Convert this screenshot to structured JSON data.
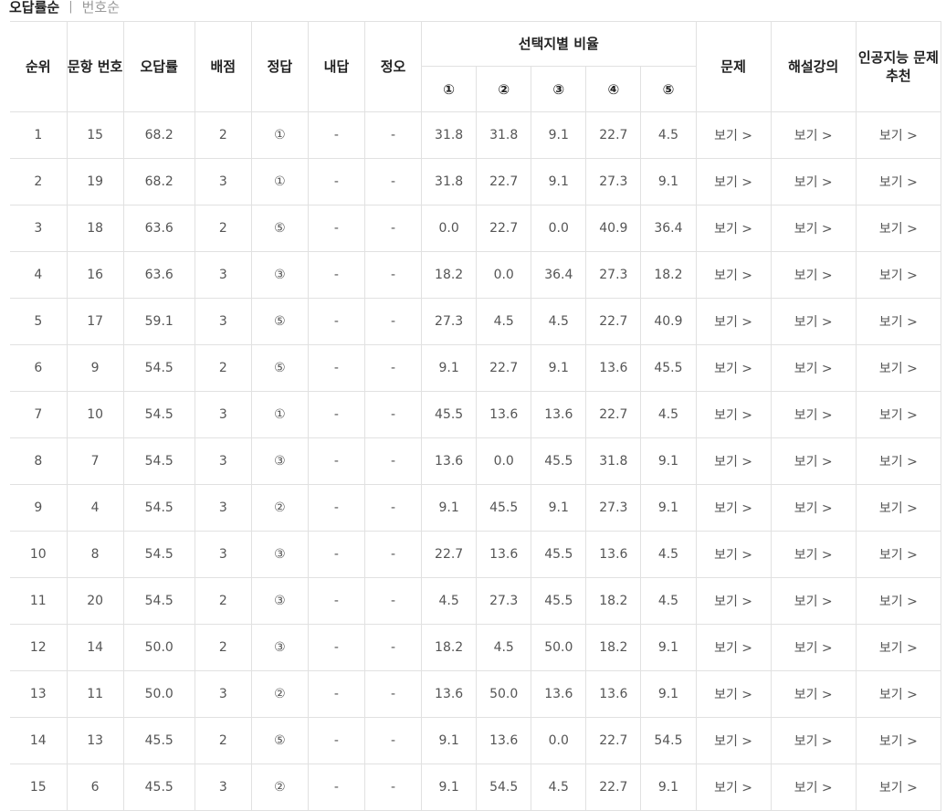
{
  "sort": {
    "active_label": "오답률순",
    "separator": "|",
    "inactive_label": "번호순"
  },
  "table": {
    "headers": {
      "rank": "순위",
      "question_no": "문항 번호",
      "wrong_rate": "오답률",
      "points": "배점",
      "answer": "정답",
      "my_answer": "내답",
      "correctness": "정오",
      "choice_ratio": "선택지별 비율",
      "choices": [
        "①",
        "②",
        "③",
        "④",
        "⑤"
      ],
      "problem": "문제",
      "lecture": "해설강의",
      "ai": "인공지능 문제추천"
    },
    "link_label": "보기 >",
    "rows": [
      {
        "rank": "1",
        "q": "15",
        "rate": "68.2",
        "pts": "2",
        "ans": "①",
        "mine": "-",
        "ox": "-",
        "r": [
          "31.8",
          "31.8",
          "9.1",
          "22.7",
          "4.5"
        ]
      },
      {
        "rank": "2",
        "q": "19",
        "rate": "68.2",
        "pts": "3",
        "ans": "①",
        "mine": "-",
        "ox": "-",
        "r": [
          "31.8",
          "22.7",
          "9.1",
          "27.3",
          "9.1"
        ]
      },
      {
        "rank": "3",
        "q": "18",
        "rate": "63.6",
        "pts": "2",
        "ans": "⑤",
        "mine": "-",
        "ox": "-",
        "r": [
          "0.0",
          "22.7",
          "0.0",
          "40.9",
          "36.4"
        ]
      },
      {
        "rank": "4",
        "q": "16",
        "rate": "63.6",
        "pts": "3",
        "ans": "③",
        "mine": "-",
        "ox": "-",
        "r": [
          "18.2",
          "0.0",
          "36.4",
          "27.3",
          "18.2"
        ]
      },
      {
        "rank": "5",
        "q": "17",
        "rate": "59.1",
        "pts": "3",
        "ans": "⑤",
        "mine": "-",
        "ox": "-",
        "r": [
          "27.3",
          "4.5",
          "4.5",
          "22.7",
          "40.9"
        ]
      },
      {
        "rank": "6",
        "q": "9",
        "rate": "54.5",
        "pts": "2",
        "ans": "⑤",
        "mine": "-",
        "ox": "-",
        "r": [
          "9.1",
          "22.7",
          "9.1",
          "13.6",
          "45.5"
        ]
      },
      {
        "rank": "7",
        "q": "10",
        "rate": "54.5",
        "pts": "3",
        "ans": "①",
        "mine": "-",
        "ox": "-",
        "r": [
          "45.5",
          "13.6",
          "13.6",
          "22.7",
          "4.5"
        ]
      },
      {
        "rank": "8",
        "q": "7",
        "rate": "54.5",
        "pts": "3",
        "ans": "③",
        "mine": "-",
        "ox": "-",
        "r": [
          "13.6",
          "0.0",
          "45.5",
          "31.8",
          "9.1"
        ]
      },
      {
        "rank": "9",
        "q": "4",
        "rate": "54.5",
        "pts": "3",
        "ans": "②",
        "mine": "-",
        "ox": "-",
        "r": [
          "9.1",
          "45.5",
          "9.1",
          "27.3",
          "9.1"
        ]
      },
      {
        "rank": "10",
        "q": "8",
        "rate": "54.5",
        "pts": "3",
        "ans": "③",
        "mine": "-",
        "ox": "-",
        "r": [
          "22.7",
          "13.6",
          "45.5",
          "13.6",
          "4.5"
        ]
      },
      {
        "rank": "11",
        "q": "20",
        "rate": "54.5",
        "pts": "2",
        "ans": "③",
        "mine": "-",
        "ox": "-",
        "r": [
          "4.5",
          "27.3",
          "45.5",
          "18.2",
          "4.5"
        ]
      },
      {
        "rank": "12",
        "q": "14",
        "rate": "50.0",
        "pts": "2",
        "ans": "③",
        "mine": "-",
        "ox": "-",
        "r": [
          "18.2",
          "4.5",
          "50.0",
          "18.2",
          "9.1"
        ]
      },
      {
        "rank": "13",
        "q": "11",
        "rate": "50.0",
        "pts": "3",
        "ans": "②",
        "mine": "-",
        "ox": "-",
        "r": [
          "13.6",
          "50.0",
          "13.6",
          "13.6",
          "9.1"
        ]
      },
      {
        "rank": "14",
        "q": "13",
        "rate": "45.5",
        "pts": "2",
        "ans": "⑤",
        "mine": "-",
        "ox": "-",
        "r": [
          "9.1",
          "13.6",
          "0.0",
          "22.7",
          "54.5"
        ]
      },
      {
        "rank": "15",
        "q": "6",
        "rate": "45.5",
        "pts": "3",
        "ans": "②",
        "mine": "-",
        "ox": "-",
        "r": [
          "9.1",
          "54.5",
          "4.5",
          "22.7",
          "9.1"
        ]
      }
    ]
  }
}
